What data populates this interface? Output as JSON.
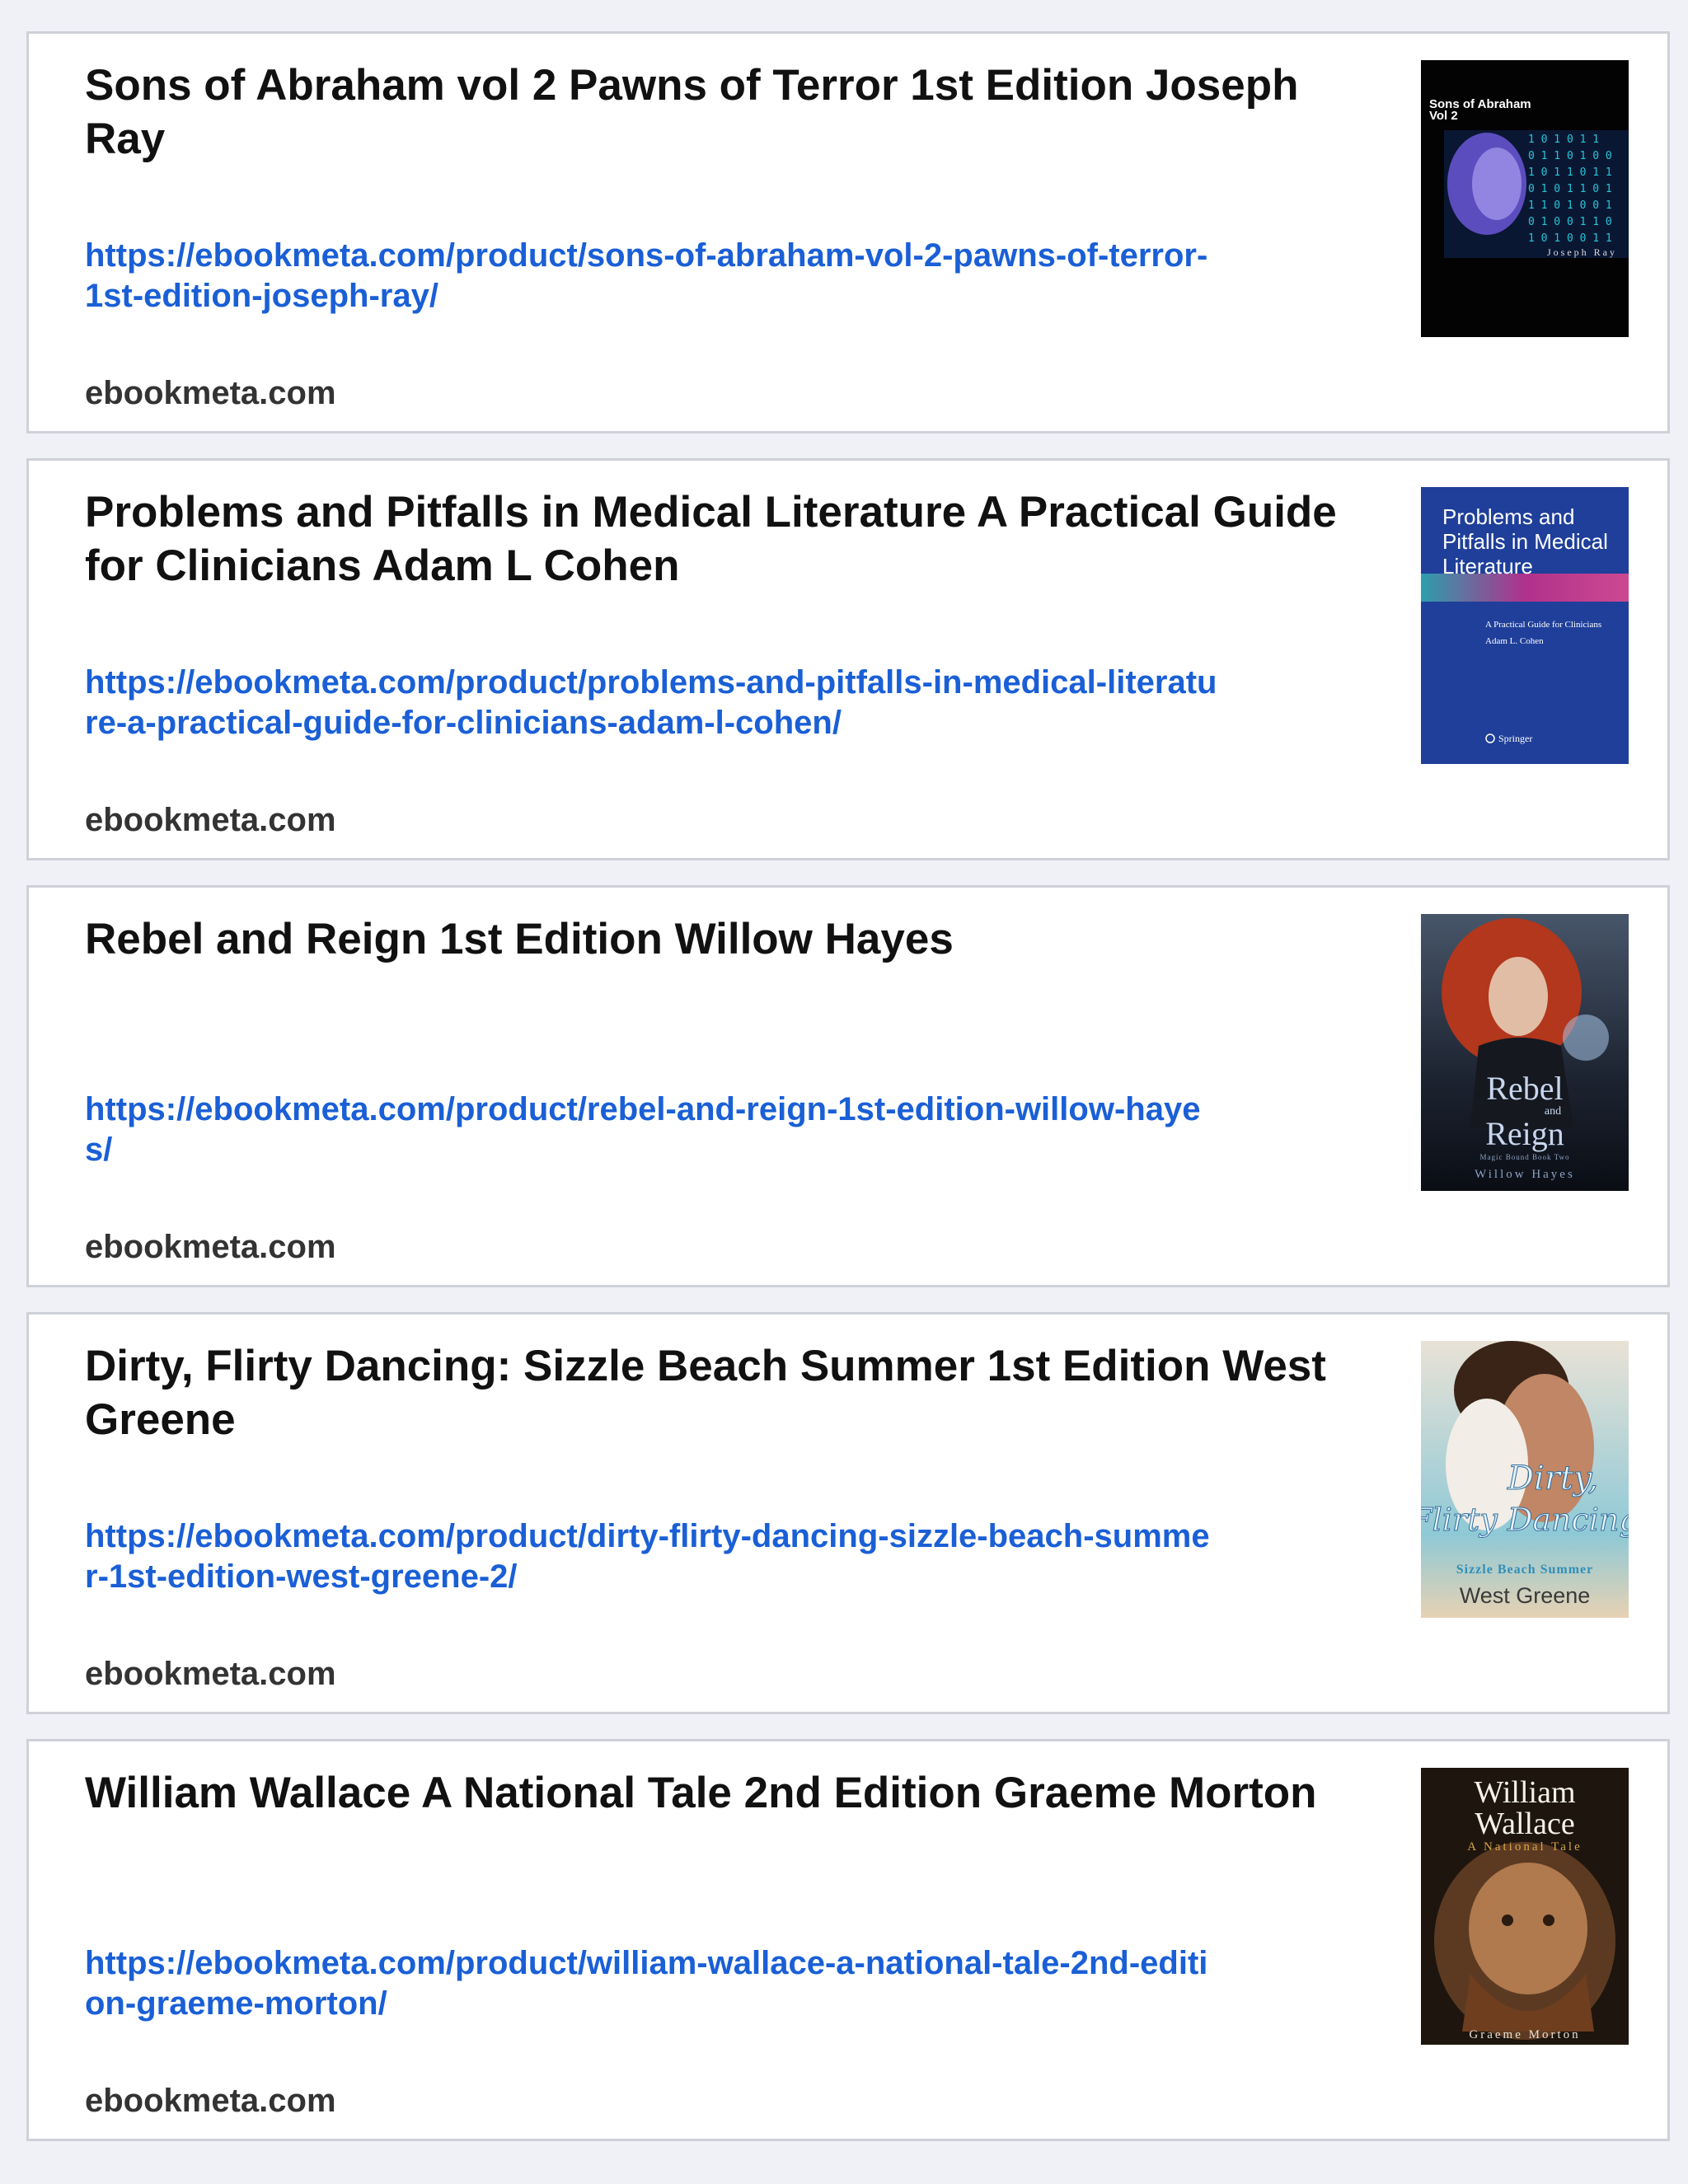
{
  "results": [
    {
      "title": "Sons of Abraham vol 2 Pawns of Terror 1st Edition Joseph Ray",
      "url": "https://ebookmeta.com/product/sons-of-abraham-vol-2-pawns-of-terror-1st-edition-joseph-ray/",
      "domain": "ebookmeta.com",
      "cover": {
        "title": "Sons of Abraham",
        "subtitle": "Vol 2",
        "author": "Joseph Ray"
      }
    },
    {
      "title": "Problems and Pitfalls in Medical Literature A Practical Guide for Clinicians Adam L Cohen",
      "url": "https://ebookmeta.com/product/problems-and-pitfalls-in-medical-literature-a-practical-guide-for-clinicians-adam-l-cohen/",
      "domain": "ebookmeta.com",
      "cover": {
        "title_1": "Problems and",
        "title_2": "Pitfalls in Medical",
        "title_3": "Literature",
        "subtitle": "A Practical Guide for Clinicians",
        "author": "Adam L. Cohen",
        "publisher": "Springer"
      }
    },
    {
      "title": "Rebel and Reign 1st Edition Willow Hayes",
      "url": "https://ebookmeta.com/product/rebel-and-reign-1st-edition-willow-hayes/",
      "domain": "ebookmeta.com",
      "cover": {
        "title_1": "Rebel",
        "title_2": "and",
        "title_3": "Reign",
        "series": "Magic Bound Book Two",
        "author": "Willow Hayes"
      }
    },
    {
      "title": "Dirty, Flirty Dancing: Sizzle Beach Summer 1st Edition West Greene",
      "url": "https://ebookmeta.com/product/dirty-flirty-dancing-sizzle-beach-summer-1st-edition-west-greene-2/",
      "domain": "ebookmeta.com",
      "cover": {
        "title_1": "Dirty,",
        "title_2": "Flirty Dancing",
        "series": "Sizzle Beach Summer",
        "author": "West Greene"
      }
    },
    {
      "title": "William Wallace A National Tale 2nd Edition Graeme Morton",
      "url": "https://ebookmeta.com/product/william-wallace-a-national-tale-2nd-edition-graeme-morton/",
      "domain": "ebookmeta.com",
      "cover": {
        "title_1": "William",
        "title_2": "Wallace",
        "subtitle": "A National Tale",
        "author": "Graeme Morton"
      }
    }
  ]
}
